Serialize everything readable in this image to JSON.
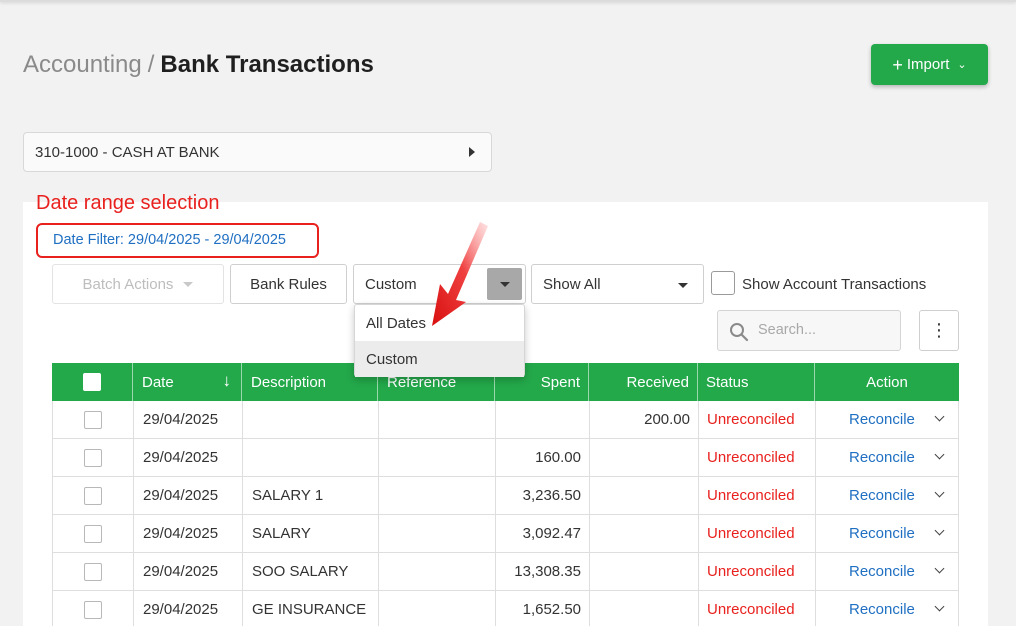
{
  "header": {
    "breadcrumb_parent": "Accounting",
    "breadcrumb_separator": "/",
    "page_title": "Bank Transactions",
    "import_label": "Import"
  },
  "account": {
    "selected": "310-1000 - CASH AT BANK"
  },
  "annotation": {
    "label": "Date range selection",
    "color": "#e8211e"
  },
  "filters": {
    "date_filter_text": "Date Filter: 29/04/2025 - 29/04/2025",
    "batch_actions_label": "Batch Actions",
    "bank_rules_label": "Bank Rules",
    "date_range_selected": "Custom",
    "date_range_options": [
      "All Dates",
      "Custom"
    ],
    "show_filter_selected": "Show All",
    "show_account_transactions_label": "Show Account Transactions",
    "search_placeholder": "Search..."
  },
  "table": {
    "columns": [
      "",
      "Date",
      "Description",
      "Reference",
      "Spent",
      "Received",
      "Status",
      "Action"
    ],
    "rows": [
      {
        "date": "29/04/2025",
        "description": "",
        "reference": "",
        "spent": "",
        "received": "200.00",
        "status": "Unreconciled",
        "action": "Reconcile"
      },
      {
        "date": "29/04/2025",
        "description": "",
        "reference": "",
        "spent": "160.00",
        "received": "",
        "status": "Unreconciled",
        "action": "Reconcile"
      },
      {
        "date": "29/04/2025",
        "description": "SALARY 1",
        "reference": "",
        "spent": "3,236.50",
        "received": "",
        "status": "Unreconciled",
        "action": "Reconcile"
      },
      {
        "date": "29/04/2025",
        "description": "SALARY",
        "reference": "",
        "spent": "3,092.47",
        "received": "",
        "status": "Unreconciled",
        "action": "Reconcile"
      },
      {
        "date": "29/04/2025",
        "description": "SOO SALARY",
        "reference": "",
        "spent": "13,308.35",
        "received": "",
        "status": "Unreconciled",
        "action": "Reconcile"
      },
      {
        "date": "29/04/2025",
        "description": "GE INSURANCE",
        "reference": "",
        "spent": "1,652.50",
        "received": "",
        "status": "Unreconciled",
        "action": "Reconcile"
      }
    ]
  },
  "colors": {
    "brand_green": "#23a84a",
    "status_red": "#e8211e",
    "link_blue": "#1f6fc2"
  },
  "icons": [
    "plus-icon",
    "chevron-down-icon",
    "caret-right-icon",
    "search-icon",
    "kebab-menu-icon",
    "sort-down-arrow-icon",
    "annotation-arrow-icon"
  ]
}
